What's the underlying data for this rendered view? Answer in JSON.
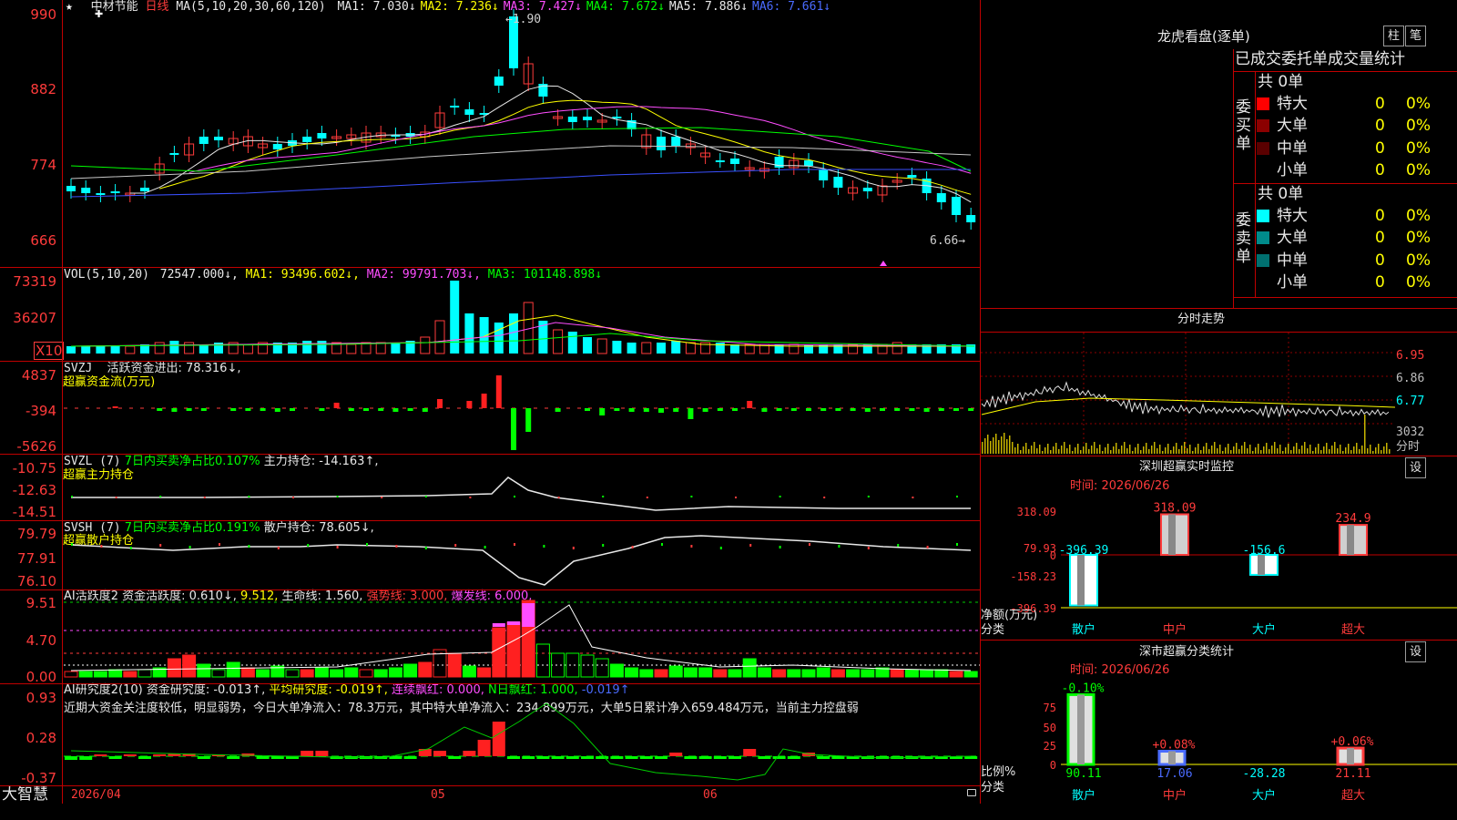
{
  "header": {
    "star": "★",
    "cross": "✚",
    "stock_name": "中材节能",
    "period": "日线",
    "ma_label": "MA(5,10,20,30,60,120)",
    "ma_items": [
      {
        "text": "MA1: 7.030↓",
        "color": "#e8e8e8"
      },
      {
        "text": "MA2: 7.236↓",
        "color": "#ffff00"
      },
      {
        "text": "MA3: 7.427↓",
        "color": "#ff4dff"
      },
      {
        "text": "MA4: 7.672↓",
        "color": "#00ff00"
      },
      {
        "text": "MA5: 7.886↓",
        "color": "#e8e8e8"
      },
      {
        "text": "MA6: 7.661↓",
        "color": "#4a6bff"
      }
    ]
  },
  "price_panel": {
    "y_ticks": [
      "990",
      "882",
      "774",
      "666"
    ],
    "high_label": "←1.90",
    "low_label": "6.66→"
  },
  "vol_panel": {
    "label": "VOL(5,10,20)",
    "value": "72547.000↓,",
    "ma1": "MA1: 93496.602↓,",
    "ma2": "MA2: 99791.703↓,",
    "ma3": "MA3: 101148.898↓",
    "y_ticks": [
      "73319",
      "36207"
    ],
    "unit": "X10"
  },
  "svzj_panel": {
    "label": "SVZJ",
    "text": "活跃资金进出: 78.316↓,",
    "subtitle": "超赢资金流(万元)",
    "y_ticks": [
      "4837",
      "-394",
      "-5626"
    ]
  },
  "svzl_panel": {
    "label": "SVZL (7)",
    "ratio": "7日内买卖净占比0.107%",
    "holding": "主力持仓: -14.163↑,",
    "subtitle": "超赢主力持仓",
    "y_ticks": [
      "-10.75",
      "-12.63",
      "-14.51"
    ]
  },
  "svsh_panel": {
    "label": "SVSH (7)",
    "ratio": "7日内买卖净占比0.191%",
    "holding": "散户持仓: 78.605↓,",
    "subtitle": "超赢散户持仓",
    "y_ticks": [
      "79.79",
      "77.91",
      "76.10"
    ]
  },
  "ai_active_panel": {
    "label": "AI活跃度2",
    "text1": "资金活跃度: 0.610↓,",
    "text2": "9.512,",
    "text3": "生命线: 1.560,",
    "text4": "强势线: 3.000,",
    "text5": "爆发线: 6.000,",
    "y_ticks": [
      "9.51",
      "4.70",
      "0.00"
    ]
  },
  "ai_research_panel": {
    "label": "AI研究度2(10)",
    "text1": "资金研究度: -0.013↑,",
    "text2": "平均研究度: -0.019↑,",
    "text3": "连续飘红: 0.000,",
    "text4": "N日飘红: 1.000,",
    "text5": "-0.019↑",
    "comment": "近期大资金关注度较低，明显弱势，今日大单净流入：78.3万元，其中特大单净流入：234.899万元，大单5日累计净入659.484万元，当前主力控盘弱",
    "y_ticks": [
      "0.93",
      "0.28",
      "-0.37"
    ]
  },
  "footer": {
    "brand": "大智慧",
    "dates": [
      "2026/04",
      "05",
      "06"
    ]
  },
  "lhb": {
    "title": "龙虎看盘(逐单)",
    "btn1": "柱",
    "btn2": "笔",
    "header": "已成交委托单成交量统计",
    "buy_side": {
      "label": "委买单",
      "total": "共 0单",
      "rows": [
        {
          "name": "特大",
          "count": "0",
          "pct": "0%",
          "color": "#ff0000"
        },
        {
          "name": "大单",
          "count": "0",
          "pct": "0%",
          "color": "#8b0000"
        },
        {
          "name": "中单",
          "count": "0",
          "pct": "0%",
          "color": "#5a0000"
        },
        {
          "name": "小单",
          "count": "0",
          "pct": "0%",
          "color": "#000000"
        }
      ]
    },
    "sell_side": {
      "label": "委卖单",
      "total": "共 0单",
      "rows": [
        {
          "name": "特大",
          "count": "0",
          "pct": "0%",
          "color": "#00ffff"
        },
        {
          "name": "大单",
          "count": "0",
          "pct": "0%",
          "color": "#008b8b"
        },
        {
          "name": "中单",
          "count": "0",
          "pct": "0%",
          "color": "#007070"
        },
        {
          "name": "小单",
          "count": "0",
          "pct": "0%",
          "color": "#000000"
        }
      ]
    }
  },
  "intraday": {
    "title": "分时走势",
    "price_ticks": [
      "6.95",
      "6.86",
      "6.77"
    ],
    "vol_tick": "3032",
    "vol_label": "分时"
  },
  "monitor": {
    "title": "深圳超赢实时监控",
    "btn": "设",
    "time": "时间: 2026/06/26",
    "y_ticks": [
      "318.09",
      "79.93",
      "0",
      "-158.23",
      "-396.39"
    ],
    "net_label": "净额(万元)",
    "cat_label": "分类",
    "categories": [
      "散户",
      "中户",
      "大户",
      "超大"
    ],
    "values": [
      -396.39,
      318.09,
      -156.6,
      234.9
    ],
    "value_labels": [
      "-396.39",
      "318.09",
      "-156.6",
      "234.9"
    ]
  },
  "classify": {
    "title": "深市超赢分类统计",
    "btn": "设",
    "time": "时间: 2026/06/26",
    "y_ticks": [
      "75",
      "50",
      "25",
      "0"
    ],
    "ratio_label": "比例%",
    "cat_label": "分类",
    "categories": [
      "散户",
      "中户",
      "大户",
      "超大"
    ],
    "bar_values": [
      90.11,
      17.06,
      0,
      21.11
    ],
    "top_labels": [
      "-0.10%",
      "+0.08%",
      "",
      "+0.06%"
    ],
    "bottom_labels": [
      "90.11",
      "17.06",
      "-28.28",
      "21.11"
    ]
  }
}
